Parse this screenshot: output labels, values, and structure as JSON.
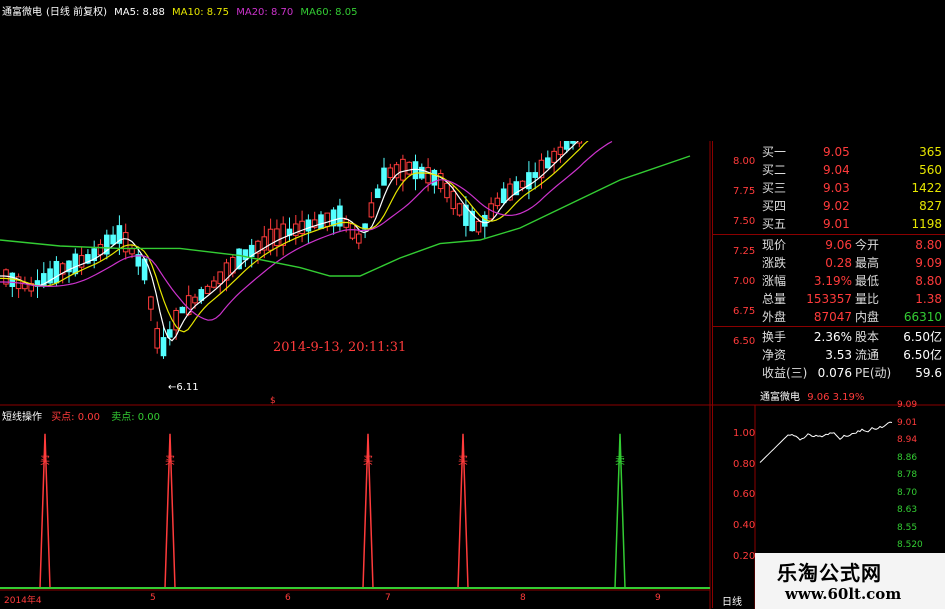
{
  "header": {
    "stock_name": "通富微电",
    "mode": "(日线 前复权)",
    "ma5": "MA5: 8.88",
    "ma10": "MA10: 8.75",
    "ma20": "MA20: 8.70",
    "ma60": "MA60: 8.05"
  },
  "main_chart": {
    "price_ticks": [
      "8.00",
      "7.75",
      "7.50",
      "7.25",
      "7.00",
      "6.75",
      "6.50"
    ],
    "low_marker": "6.11",
    "timestamp": "2014-9-13, 20:11:31",
    "dollar_mark": "$"
  },
  "indicator": {
    "title": "短线操作",
    "buy_label": "买点: 0.00",
    "sell_label": "卖点: 0.00",
    "ticks": [
      "1.00",
      "0.80",
      "0.60",
      "0.40",
      "0.20"
    ],
    "buy_marker": "买",
    "sell_marker": "卖"
  },
  "x_axis": {
    "labels": [
      "2014年4",
      "5",
      "6",
      "7",
      "8",
      "9"
    ],
    "period": "日线"
  },
  "quote": {
    "orders": [
      {
        "label": "买一",
        "price": "9.05",
        "volume": "365"
      },
      {
        "label": "买二",
        "price": "9.04",
        "volume": "560"
      },
      {
        "label": "买三",
        "price": "9.03",
        "volume": "1422"
      },
      {
        "label": "买四",
        "price": "9.02",
        "volume": "827"
      },
      {
        "label": "买五",
        "price": "9.01",
        "volume": "1198"
      }
    ],
    "stats": [
      {
        "l1": "现价",
        "v1": "9.06",
        "l2": "今开",
        "v2": "8.80"
      },
      {
        "l1": "涨跌",
        "v1": "0.28",
        "l2": "最高",
        "v2": "9.09"
      },
      {
        "l1": "涨幅",
        "v1": "3.19%",
        "l2": "最低",
        "v2": "8.80"
      },
      {
        "l1": "总量",
        "v1": "153357",
        "l2": "量比",
        "v2": "1.38"
      },
      {
        "l1": "外盘",
        "v1": "87047",
        "l2": "内盘",
        "v2": "66310"
      }
    ],
    "fund": [
      {
        "l1": "换手",
        "v1": "2.36%",
        "l2": "股本",
        "v2": "6.50亿"
      },
      {
        "l1": "净资",
        "v1": "3.53",
        "l2": "流通",
        "v2": "6.50亿"
      },
      {
        "l1": "收益(三)",
        "v1": "0.076",
        "l2": "PE(动)",
        "v2": "59.6"
      }
    ]
  },
  "mini_chart": {
    "name": "通富微电",
    "price_pct": "9.06  3.19%",
    "ticks": [
      "9.09",
      "9.01",
      "8.94",
      "8.86",
      "8.78",
      "8.70",
      "8.63",
      "8.55",
      "8.520"
    ]
  },
  "watermark": {
    "line1": "乐淘公式网",
    "line2": "www.60lt.com"
  },
  "colors": {
    "up": "#ff3b3b",
    "down": "#54ffff",
    "ma5": "#ffffff",
    "ma10": "#e6e600",
    "ma20": "#cc33cc",
    "ma60": "#33cc33",
    "grid": "#8b0000"
  }
}
